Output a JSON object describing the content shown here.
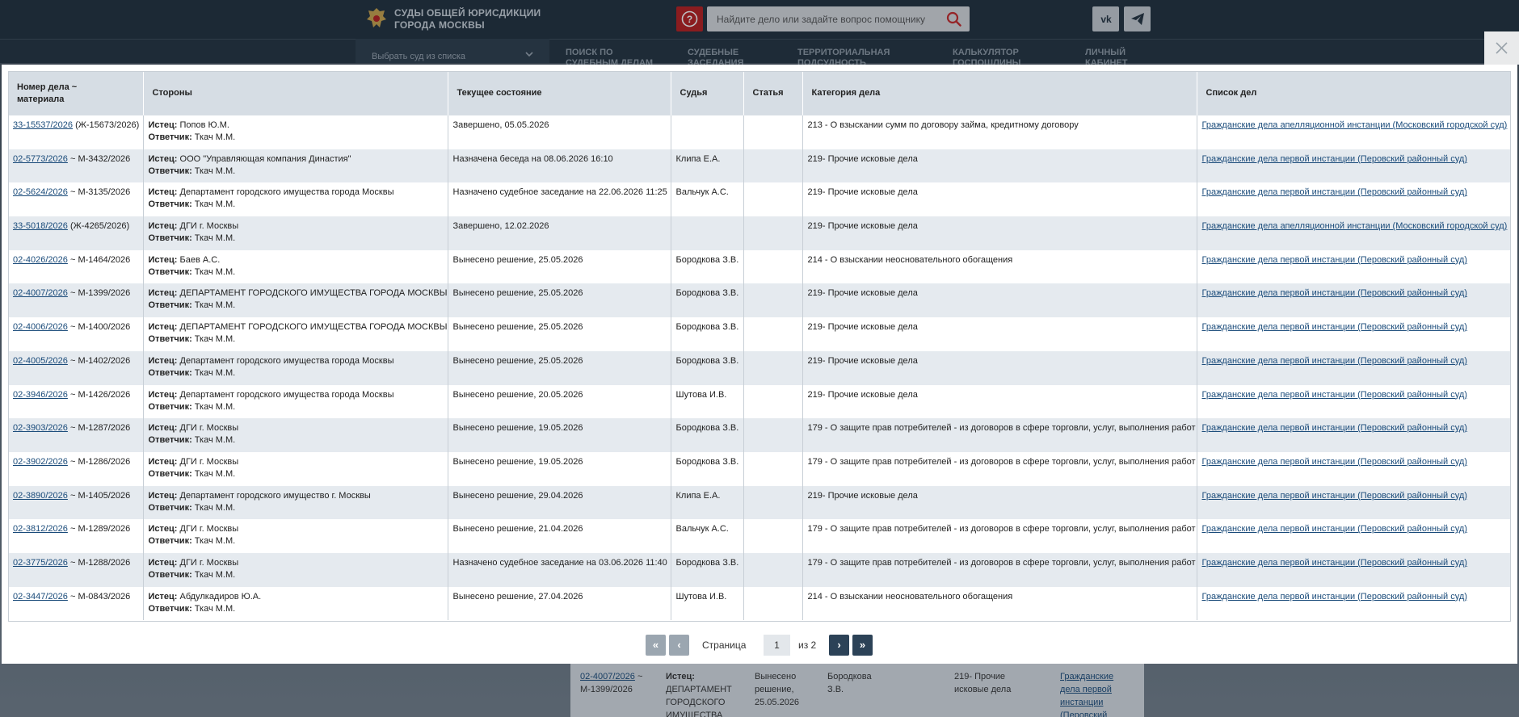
{
  "site": {
    "brand_line1": "СУДЫ ОБЩЕЙ ЮРИСДИКЦИИ",
    "brand_line2": "ГОРОДА МОСКВЫ",
    "search_placeholder": "Найдите дело или задайте вопрос помощнику",
    "court_select": "Выбрать суд из списка",
    "nav": [
      {
        "line1": "ПОИСК ПО",
        "line2": "СУДЕБНЫМ ДЕЛАМ"
      },
      {
        "line1": "СУДЕБНЫЕ",
        "line2": "ЗАСЕДАНИЯ"
      },
      {
        "line1": "ТЕРРИТОРИАЛЬНАЯ",
        "line2": "ПОДСУДНОСТЬ"
      },
      {
        "line1": "КАЛЬКУЛЯТОР",
        "line2": "ГОСПОШЛИНЫ"
      },
      {
        "line1": "ЛИЧНЫЙ",
        "line2": "КАБИНЕТ"
      }
    ],
    "bg_row": {
      "num_link": "02-4007/2026",
      "num_rest": "~",
      "num_line2": "М-1399/2026",
      "plaintiff_label": "Истец:",
      "plaintiff_l1": "ДЕПАРТАМЕНТ",
      "plaintiff_l2": "ГОРОДСКОГО",
      "plaintiff_l3": "ИМУЩЕСТВА",
      "state_l1": "Вынесено",
      "state_l2": "решение,",
      "state_l3": "25.05.2026",
      "judge_l1": "Бородкова",
      "judge_l2": "З.В.",
      "cat_l1": "219- Прочие",
      "cat_l2": "исковые дела",
      "list_l1": "Гражданские",
      "list_l2": "дела первой",
      "list_l3": "инстанции",
      "list_l4": "(Перовский"
    }
  },
  "table": {
    "headers": {
      "num_l1": "Номер дела ~",
      "num_l2": "материала",
      "parties": "Стороны",
      "state": "Текущее состояние",
      "judge": "Судья",
      "article": "Статья",
      "category": "Категория дела",
      "list": "Список дел"
    },
    "plaintiff_label": "Истец:",
    "defendant_label": "Ответчик:",
    "rows": [
      {
        "link": "33-15537/2026",
        "rest": " (Ж-15673/2026)",
        "plaintiff": " Попов Ю.М.",
        "defendant": " Ткач М.М.",
        "state": "Завершено, 05.05.2026",
        "judge": "",
        "article": "",
        "category": "213 - О взыскании сумм по договору займа, кредитному договору",
        "list": "Гражданские дела апелляционной инстанции (Московский городской суд)"
      },
      {
        "link": "02-5773/2026",
        "rest": " ~ М-3432/2026",
        "plaintiff": " ООО \"Управляющая компания Династия\"",
        "defendant": " Ткач М.М.",
        "state": "Назначена беседа на 08.06.2026 16:10",
        "judge": "Клипа Е.А.",
        "article": "",
        "category": "219- Прочие исковые дела",
        "list": "Гражданские дела первой инстанции (Перовский районный суд)"
      },
      {
        "link": "02-5624/2026",
        "rest": " ~ М-3135/2026",
        "plaintiff": " Департамент городского имущества города Москвы",
        "defendant": " Ткач М.М.",
        "state": "Назначено судебное заседание на 22.06.2026 11:25",
        "judge": "Вальчук А.С.",
        "article": "",
        "category": "219- Прочие исковые дела",
        "list": "Гражданские дела первой инстанции (Перовский районный суд)"
      },
      {
        "link": "33-5018/2026",
        "rest": " (Ж-4265/2026)",
        "plaintiff": " ДГИ г. Москвы",
        "defendant": " Ткач М.М.",
        "state": "Завершено, 12.02.2026",
        "judge": "",
        "article": "",
        "category": "219- Прочие исковые дела",
        "list": "Гражданские дела апелляционной инстанции (Московский городской суд)"
      },
      {
        "link": "02-4026/2026",
        "rest": " ~ М-1464/2026",
        "plaintiff": " Баев А.С.",
        "defendant": " Ткач М.М.",
        "state": "Вынесено решение, 25.05.2026",
        "judge": "Бородкова З.В.",
        "article": "",
        "category": "214 - О взыскании неосновательного обогащения",
        "list": "Гражданские дела первой инстанции (Перовский районный суд)"
      },
      {
        "link": "02-4007/2026",
        "rest": " ~ М-1399/2026",
        "plaintiff": " ДЕПАРТАМЕНТ ГОРОДСКОГО ИМУЩЕСТВА ГОРОДА МОСКВЫ",
        "defendant": " Ткач М.М.",
        "state": "Вынесено решение, 25.05.2026",
        "judge": "Бородкова З.В.",
        "article": "",
        "category": "219- Прочие исковые дела",
        "list": "Гражданские дела первой инстанции (Перовский районный суд)"
      },
      {
        "link": "02-4006/2026",
        "rest": " ~ М-1400/2026",
        "plaintiff": " ДЕПАРТАМЕНТ ГОРОДСКОГО ИМУЩЕСТВА ГОРОДА МОСКВЫ",
        "defendant": " Ткач М.М.",
        "state": "Вынесено решение, 25.05.2026",
        "judge": "Бородкова З.В.",
        "article": "",
        "category": "219- Прочие исковые дела",
        "list": "Гражданские дела первой инстанции (Перовский районный суд)"
      },
      {
        "link": "02-4005/2026",
        "rest": " ~ М-1402/2026",
        "plaintiff": " Департамент городского имущества города Москвы",
        "defendant": " Ткач М.М.",
        "state": "Вынесено решение, 25.05.2026",
        "judge": "Бородкова З.В.",
        "article": "",
        "category": "219- Прочие исковые дела",
        "list": "Гражданские дела первой инстанции (Перовский районный суд)"
      },
      {
        "link": "02-3946/2026",
        "rest": " ~ М-1426/2026",
        "plaintiff": " Департамент городского имущества города Москвы",
        "defendant": " Ткач М.М.",
        "state": "Вынесено решение, 20.05.2026",
        "judge": "Шутова И.В.",
        "article": "",
        "category": "219- Прочие исковые дела",
        "list": "Гражданские дела первой инстанции (Перовский районный суд)"
      },
      {
        "link": "02-3903/2026",
        "rest": " ~ М-1287/2026",
        "plaintiff": " ДГИ г. Москвы",
        "defendant": " Ткач М.М.",
        "state": "Вынесено решение, 19.05.2026",
        "judge": "Бородкова З.В.",
        "article": "",
        "category": "179 - О защите прав потребителей - из договоров в сфере торговли, услуг, выполнения работ",
        "list": "Гражданские дела первой инстанции (Перовский районный суд)"
      },
      {
        "link": "02-3902/2026",
        "rest": " ~ М-1286/2026",
        "plaintiff": " ДГИ г. Москвы",
        "defendant": " Ткач М.М.",
        "state": "Вынесено решение, 19.05.2026",
        "judge": "Бородкова З.В.",
        "article": "",
        "category": "179 - О защите прав потребителей - из договоров в сфере торговли, услуг, выполнения работ",
        "list": "Гражданские дела первой инстанции (Перовский районный суд)"
      },
      {
        "link": "02-3890/2026",
        "rest": " ~ М-1405/2026",
        "plaintiff": " Департамент городского имущество г. Москвы",
        "defendant": " Ткач М.М.",
        "state": "Вынесено решение, 29.04.2026",
        "judge": "Клипа Е.А.",
        "article": "",
        "category": "219- Прочие исковые дела",
        "list": "Гражданские дела первой инстанции (Перовский районный суд)"
      },
      {
        "link": "02-3812/2026",
        "rest": " ~ М-1289/2026",
        "plaintiff": " ДГИ г. Москвы",
        "defendant": " Ткач М.М.",
        "state": "Вынесено решение, 21.04.2026",
        "judge": "Вальчук А.С.",
        "article": "",
        "category": "179 - О защите прав потребителей - из договоров в сфере торговли, услуг, выполнения работ",
        "list": "Гражданские дела первой инстанции (Перовский районный суд)"
      },
      {
        "link": "02-3775/2026",
        "rest": " ~ М-1288/2026",
        "plaintiff": " ДГИ г. Москвы",
        "defendant": " Ткач М.М.",
        "state": "Назначено судебное заседание на 03.06.2026 11:40",
        "judge": "Бородкова З.В.",
        "article": "",
        "category": "179 - О защите прав потребителей - из договоров в сфере торговли, услуг, выполнения работ",
        "list": "Гражданские дела первой инстанции (Перовский районный суд)"
      },
      {
        "link": "02-3447/2026",
        "rest": " ~ М-0843/2026",
        "plaintiff": " Абдулкадиров Ю.А.",
        "defendant": " Ткач М.М.",
        "state": "Вынесено решение, 27.04.2026",
        "judge": "Шутова И.В.",
        "article": "",
        "category": "214 - О взыскании неосновательного обогащения",
        "list": "Гражданские дела первой инстанции (Перовский районный суд)"
      }
    ]
  },
  "pager": {
    "first": "«",
    "prev": "‹",
    "label": "Страница",
    "current": "1",
    "of": "из 2",
    "next": "›",
    "last": "»"
  },
  "colors": {
    "header_bg": "#1f2e3b",
    "row_alt": "#e5eaef",
    "th_bg": "#d6dde4",
    "link": "#1a4b7a",
    "pager_active": "#2c4257",
    "help_red": "#b71c1c"
  },
  "icons": {
    "logo": "coat-of-arms-icon",
    "help": "question-circle-icon",
    "search": "search-icon",
    "vk": "vk-icon",
    "telegram": "telegram-icon",
    "close": "close-icon",
    "chevron": "chevron-down-icon"
  }
}
